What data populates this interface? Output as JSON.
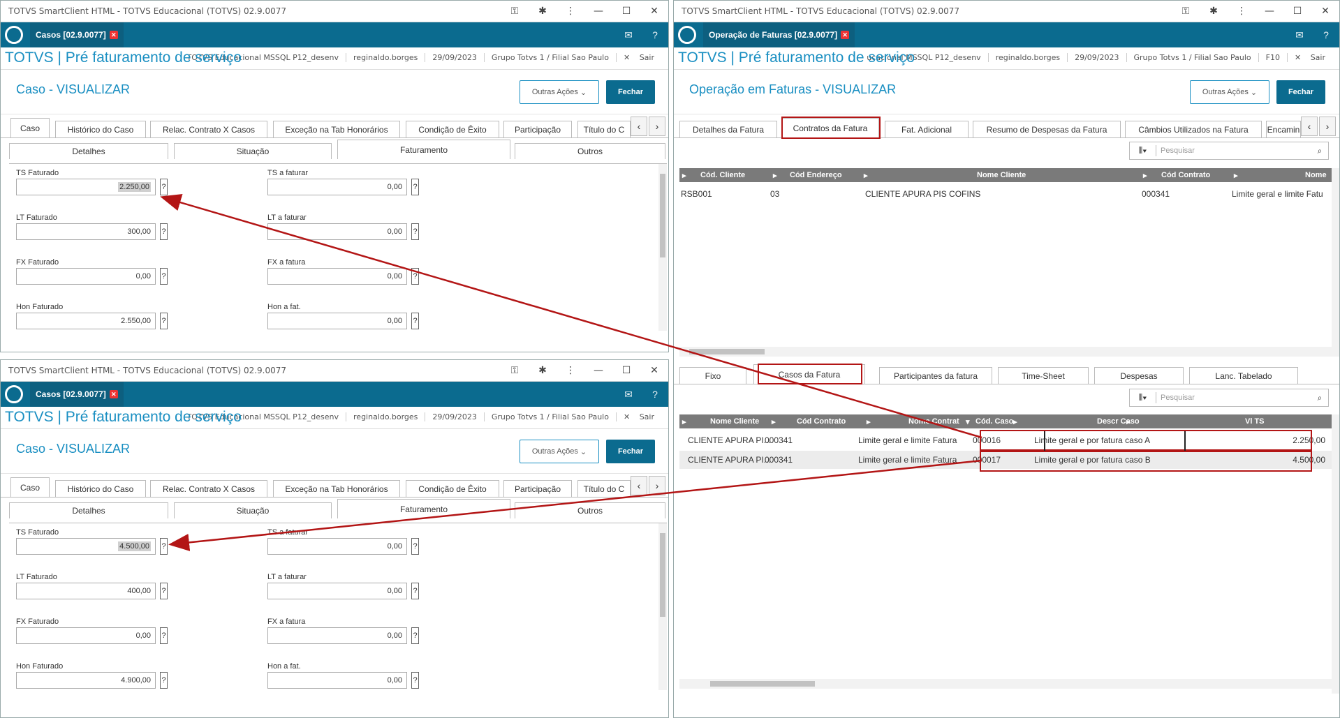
{
  "app": {
    "chrome_title": "TOTVS SmartClient HTML - TOTVS Educacional (TOTVS) 02.9.0077",
    "brand": "TOTVS | Pré faturamento de serviço",
    "info": [
      "TOTVS Educacional MSSQL P12_desenv",
      "reginaldo.borges",
      "29/09/2023",
      "Grupo Totvs 1 / Filial Sao Paulo"
    ],
    "info_right": [
      "ucacional MSSQL P12_desenv",
      "reginaldo.borges",
      "29/09/2023",
      "Grupo Totvs 1 / Filial Sao Paulo",
      "F10"
    ],
    "exit_label": "Sair",
    "outras_acoes": "Outras Ações",
    "fechar": "Fechar",
    "search_placeholder": "Pesquisar"
  },
  "left_top": {
    "tab": "Casos [02.9.0077]",
    "page_title": "Caso - VISUALIZAR",
    "tabs": [
      "Caso",
      "Histórico do Caso",
      "Relac. Contrato X Casos",
      "Exceção na Tab Honorários",
      "Condição de Êxito",
      "Participação",
      "Título do C"
    ],
    "subtabs": [
      "Detalhes",
      "Situação",
      "Faturamento",
      "Outros"
    ],
    "fields": {
      "ts_faturado_label": "TS Faturado",
      "ts_faturado": "2.250,00",
      "ts_afaturar_label": "TS a faturar",
      "ts_afaturar": "0,00",
      "lt_faturado_label": "LT Faturado",
      "lt_faturado": "300,00",
      "lt_afaturar_label": "LT a faturar",
      "lt_afaturar": "0,00",
      "fx_faturado_label": "FX Faturado",
      "fx_faturado": "0,00",
      "fx_afatura_label": "FX a fatura",
      "fx_afatura": "0,00",
      "hon_faturado_label": "Hon Faturado",
      "hon_faturado": "2.550,00",
      "hon_afat_label": "Hon a fat.",
      "hon_afat": "0,00"
    }
  },
  "left_bottom": {
    "tab": "Casos [02.9.0077]",
    "page_title": "Caso - VISUALIZAR",
    "fields": {
      "ts_faturado_label": "TS Faturado",
      "ts_faturado": "4.500,00",
      "ts_afaturar_label": "TS a faturar",
      "ts_afaturar": "0,00",
      "lt_faturado_label": "LT Faturado",
      "lt_faturado": "400,00",
      "lt_afaturar_label": "LT a faturar",
      "lt_afaturar": "0,00",
      "fx_faturado_label": "FX Faturado",
      "fx_faturado": "0,00",
      "fx_afatura_label": "FX a fatura",
      "fx_afatura": "0,00",
      "hon_faturado_label": "Hon Faturado",
      "hon_faturado": "4.900,00",
      "hon_afat_label": "Hon a fat.",
      "hon_afat": "0,00"
    }
  },
  "right": {
    "tab": "Operação de Faturas [02.9.0077]",
    "page_title": "Operação em Faturas - VISUALIZAR",
    "tabs": [
      "Detalhes da Fatura",
      "Contratos da Fatura",
      "Fat. Adicional",
      "Resumo de Despesas da Fatura",
      "Câmbios Utilizados na Fatura",
      "Encamin"
    ],
    "grid1_headers": [
      "Cód. Cliente",
      "Cód Endereço",
      "Nome Cliente",
      "Cód Contrato",
      "Nome"
    ],
    "grid1_row": [
      "RSB001",
      "03",
      "CLIENTE APURA PIS COFINS",
      "000341",
      "Limite geral e limite Fatu"
    ],
    "tabs2": [
      "Fixo",
      "Casos da Fatura",
      "Participantes da fatura",
      "Time-Sheet",
      "Despesas",
      "Lanc. Tabelado"
    ],
    "grid2_headers": [
      "Nome Cliente",
      "Cód Contrato",
      "Nome Contrat",
      "Cód. Caso",
      "Descr Caso",
      "Vl TS"
    ],
    "grid2_rows": [
      [
        "CLIENTE APURA PI...",
        "000341",
        "Limite geral e limite Fatura",
        "000016",
        "Limite geral e por fatura caso A",
        "2.250,00"
      ],
      [
        "CLIENTE APURA PI...",
        "000341",
        "Limite geral e limite Fatura",
        "000017",
        "Limite geral e por fatura caso B",
        "4.500,00"
      ]
    ]
  },
  "colors": {
    "appbar": "#0b6b8f",
    "brand": "#1a8fc2",
    "annotation": "#b31515"
  }
}
